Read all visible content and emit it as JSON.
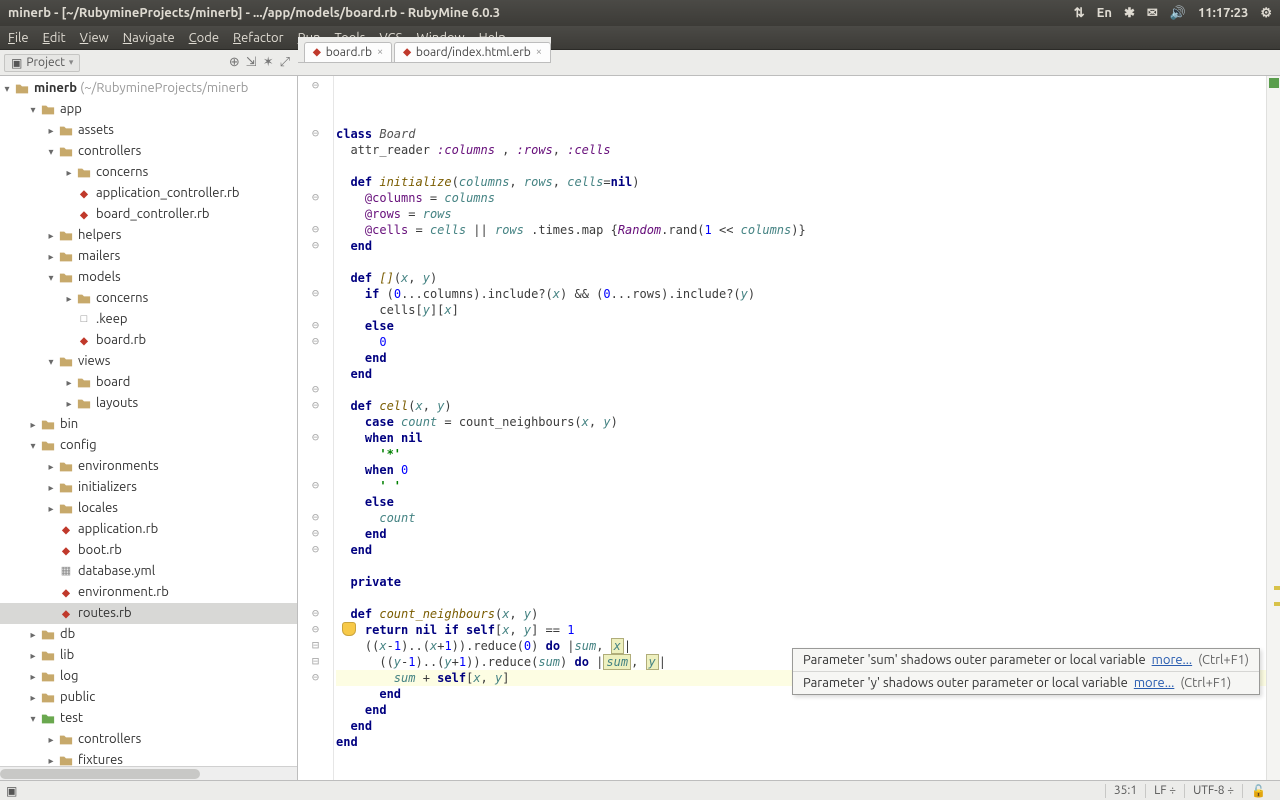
{
  "titlebar": {
    "title": "minerb - [~/RubymineProjects/minerb] - .../app/models/board.rb - RubyMine 6.0.3",
    "tray": {
      "time": "11:17:23",
      "lang": "En"
    }
  },
  "menubar": [
    "File",
    "Edit",
    "View",
    "Navigate",
    "Code",
    "Refactor",
    "Run",
    "Tools",
    "VCS",
    "Window",
    "Help"
  ],
  "toolpanel": {
    "label": "Project"
  },
  "project_tree": {
    "root": {
      "name": "minerb",
      "hint": "(~/RubymineProjects/minerb"
    },
    "nodes": [
      {
        "d": 1,
        "t": "dir",
        "open": true,
        "n": "app"
      },
      {
        "d": 2,
        "t": "dir",
        "open": false,
        "n": "assets"
      },
      {
        "d": 2,
        "t": "dir",
        "open": true,
        "n": "controllers"
      },
      {
        "d": 3,
        "t": "dir",
        "open": false,
        "n": "concerns"
      },
      {
        "d": 3,
        "t": "rb",
        "n": "application_controller.rb"
      },
      {
        "d": 3,
        "t": "rb",
        "n": "board_controller.rb"
      },
      {
        "d": 2,
        "t": "dir",
        "open": false,
        "n": "helpers"
      },
      {
        "d": 2,
        "t": "dir",
        "open": false,
        "n": "mailers"
      },
      {
        "d": 2,
        "t": "dir",
        "open": true,
        "n": "models"
      },
      {
        "d": 3,
        "t": "dir",
        "open": false,
        "n": "concerns"
      },
      {
        "d": 3,
        "t": "file",
        "n": ".keep"
      },
      {
        "d": 3,
        "t": "rb",
        "n": "board.rb"
      },
      {
        "d": 2,
        "t": "dir",
        "open": true,
        "n": "views"
      },
      {
        "d": 3,
        "t": "dir",
        "open": false,
        "n": "board"
      },
      {
        "d": 3,
        "t": "dir",
        "open": false,
        "n": "layouts"
      },
      {
        "d": 1,
        "t": "dir",
        "open": false,
        "n": "bin"
      },
      {
        "d": 1,
        "t": "dir",
        "open": true,
        "n": "config"
      },
      {
        "d": 2,
        "t": "dir",
        "open": false,
        "n": "environments"
      },
      {
        "d": 2,
        "t": "dir",
        "open": false,
        "n": "initializers"
      },
      {
        "d": 2,
        "t": "dir",
        "open": false,
        "n": "locales"
      },
      {
        "d": 2,
        "t": "rb",
        "n": "application.rb"
      },
      {
        "d": 2,
        "t": "rb",
        "n": "boot.rb"
      },
      {
        "d": 2,
        "t": "yml",
        "n": "database.yml"
      },
      {
        "d": 2,
        "t": "rb",
        "n": "environment.rb"
      },
      {
        "d": 2,
        "t": "rb",
        "n": "routes.rb",
        "sel": true
      },
      {
        "d": 1,
        "t": "dir",
        "open": false,
        "n": "db"
      },
      {
        "d": 1,
        "t": "dir",
        "open": false,
        "n": "lib"
      },
      {
        "d": 1,
        "t": "dir",
        "open": false,
        "n": "log"
      },
      {
        "d": 1,
        "t": "dir",
        "open": false,
        "n": "public"
      },
      {
        "d": 1,
        "t": "dir",
        "open": true,
        "test": true,
        "n": "test"
      },
      {
        "d": 2,
        "t": "dir",
        "open": false,
        "n": "controllers"
      },
      {
        "d": 2,
        "t": "dir",
        "open": false,
        "n": "fixtures"
      }
    ]
  },
  "tabs": [
    {
      "label": "board.rb",
      "icon": "rb"
    },
    {
      "label": "board/index.html.erb",
      "icon": "rb"
    }
  ],
  "gutter_folds": [
    1,
    0,
    0,
    1,
    0,
    0,
    0,
    1,
    0,
    1,
    1,
    0,
    0,
    1,
    0,
    1,
    1,
    0,
    0,
    1,
    1,
    0,
    1,
    0,
    0,
    1,
    0,
    1,
    1,
    1,
    0,
    0,
    0,
    1,
    1,
    2,
    2,
    1,
    0,
    1,
    1,
    1,
    1
  ],
  "code_lines": [
    [
      [
        "kw",
        "class "
      ],
      [
        "cls",
        "Board"
      ]
    ],
    [
      [
        "",
        "  attr_reader "
      ],
      [
        "sym",
        ":columns"
      ],
      [
        "",
        ""
      ],
      [
        "",
        " , "
      ],
      [
        "sym",
        ":rows"
      ],
      [
        "",
        ", "
      ],
      [
        "sym",
        ":cells"
      ]
    ],
    [
      [
        "",
        ""
      ]
    ],
    [
      [
        "",
        "  "
      ],
      [
        "kw",
        "def "
      ],
      [
        "fn",
        "initialize"
      ],
      [
        "",
        "("
      ],
      [
        "prm",
        "columns"
      ],
      [
        "",
        ", "
      ],
      [
        "prm",
        "rows"
      ],
      [
        "",
        ", "
      ],
      [
        "prm",
        "cells"
      ],
      [
        "",
        "="
      ],
      [
        "kw",
        "nil"
      ],
      [
        "",
        ")"
      ]
    ],
    [
      [
        "",
        "    "
      ],
      [
        "iv",
        "@columns"
      ],
      [
        "",
        ""
      ],
      [
        "",
        ""
      ],
      [
        "",
        " = "
      ],
      [
        "prm",
        "columns"
      ]
    ],
    [
      [
        "",
        "    "
      ],
      [
        "iv",
        "@rows"
      ],
      [
        "",
        ""
      ],
      [
        "",
        " = "
      ],
      [
        "prm",
        "rows"
      ]
    ],
    [
      [
        "",
        "    "
      ],
      [
        "iv",
        "@cells"
      ],
      [
        "",
        ""
      ],
      [
        "",
        " = "
      ],
      [
        "prm",
        "cells"
      ],
      [
        "",
        ""
      ],
      [
        "",
        " || "
      ],
      [
        "prm",
        "rows"
      ],
      [
        "",
        " .times.map {"
      ],
      [
        "cnst",
        "Random"
      ],
      [
        "",
        ".rand("
      ],
      [
        "num",
        "1"
      ],
      [
        "",
        ""
      ],
      [
        "",
        " << "
      ],
      [
        "prm",
        "columns"
      ],
      [
        "",
        ")}"
      ]
    ],
    [
      [
        "",
        "  "
      ],
      [
        "kw",
        "end"
      ]
    ],
    [
      [
        "",
        ""
      ]
    ],
    [
      [
        "",
        "  "
      ],
      [
        "kw",
        "def "
      ],
      [
        "fn",
        "[]"
      ],
      [
        "",
        "("
      ],
      [
        "prm",
        "x"
      ],
      [
        "",
        ", "
      ],
      [
        "prm",
        "y"
      ],
      [
        "",
        ")"
      ]
    ],
    [
      [
        "",
        "    "
      ],
      [
        "kw",
        "if "
      ],
      [
        "",
        "("
      ],
      [
        "num",
        "0"
      ],
      [
        "",
        "...columns).include?("
      ],
      [
        "prm",
        "x"
      ],
      [
        "",
        ") && ("
      ],
      [
        "num",
        "0"
      ],
      [
        "",
        "...rows).include?("
      ],
      [
        "prm",
        "y"
      ],
      [
        "",
        ")"
      ]
    ],
    [
      [
        "",
        "      cells["
      ],
      [
        "prm",
        "y"
      ],
      [
        "",
        "]["
      ],
      [
        "prm",
        "x"
      ],
      [
        "",
        "]"
      ]
    ],
    [
      [
        "",
        "    "
      ],
      [
        "kw",
        "else"
      ]
    ],
    [
      [
        "",
        "      "
      ],
      [
        "num",
        "0"
      ]
    ],
    [
      [
        "",
        "    "
      ],
      [
        "kw",
        "end"
      ]
    ],
    [
      [
        "",
        "  "
      ],
      [
        "kw",
        "end"
      ]
    ],
    [
      [
        "",
        ""
      ]
    ],
    [
      [
        "",
        "  "
      ],
      [
        "kw",
        "def "
      ],
      [
        "fn",
        "cell"
      ],
      [
        "",
        "("
      ],
      [
        "prm",
        "x"
      ],
      [
        "",
        ", "
      ],
      [
        "prm",
        "y"
      ],
      [
        "",
        ")"
      ]
    ],
    [
      [
        "",
        "    "
      ],
      [
        "kw",
        "case "
      ],
      [
        "prm",
        "count"
      ],
      [
        "",
        ""
      ],
      [
        "",
        " = count_neighbours("
      ],
      [
        "prm",
        "x"
      ],
      [
        "",
        ", "
      ],
      [
        "prm",
        "y"
      ],
      [
        "",
        ")"
      ]
    ],
    [
      [
        "",
        "    "
      ],
      [
        "kw",
        "when "
      ],
      [
        "kw",
        "nil"
      ]
    ],
    [
      [
        "",
        "      "
      ],
      [
        "str",
        "'*'"
      ]
    ],
    [
      [
        "",
        "    "
      ],
      [
        "kw",
        "when "
      ],
      [
        "num",
        "0"
      ]
    ],
    [
      [
        "",
        "      "
      ],
      [
        "str",
        "' '"
      ]
    ],
    [
      [
        "",
        "    "
      ],
      [
        "kw",
        "else"
      ]
    ],
    [
      [
        "",
        "      "
      ],
      [
        "prm",
        "count"
      ]
    ],
    [
      [
        "",
        "    "
      ],
      [
        "kw",
        "end"
      ]
    ],
    [
      [
        "",
        "  "
      ],
      [
        "kw",
        "end"
      ]
    ],
    [
      [
        "",
        ""
      ]
    ],
    [
      [
        "",
        "  "
      ],
      [
        "kw",
        "private"
      ]
    ],
    [
      [
        "",
        ""
      ]
    ],
    [
      [
        "",
        "  "
      ],
      [
        "kw",
        "def "
      ],
      [
        "fn",
        "count_neighbours"
      ],
      [
        "",
        "("
      ],
      [
        "prm",
        "x"
      ],
      [
        "",
        ", "
      ],
      [
        "prm",
        "y"
      ],
      [
        "",
        ")"
      ]
    ],
    [
      [
        "",
        "    "
      ],
      [
        "kw",
        "return nil if self"
      ],
      [
        "",
        "["
      ],
      [
        "prm",
        "x"
      ],
      [
        "",
        ", "
      ],
      [
        "prm",
        "y"
      ],
      [
        "",
        "] == "
      ],
      [
        "num",
        "1"
      ]
    ],
    [
      [
        "",
        "    (("
      ],
      [
        "prm",
        "x"
      ],
      [
        "",
        "-"
      ],
      [
        "num",
        "1"
      ],
      [
        "",
        ")..("
      ],
      [
        "prm",
        "x"
      ],
      [
        "",
        "+"
      ],
      [
        "num",
        "1"
      ],
      [
        "",
        ")).reduce("
      ],
      [
        "num",
        "0"
      ],
      [
        "",
        ") "
      ],
      [
        "kw",
        "do"
      ],
      [
        "",
        ""
      ],
      [
        "",
        " |"
      ],
      [
        "prm",
        "sum"
      ],
      [
        "",
        ", "
      ],
      [
        "warn",
        "x"
      ],
      [
        "",
        "|"
      ]
    ],
    [
      [
        "",
        "      (("
      ],
      [
        "prm",
        "y"
      ],
      [
        "",
        "-"
      ],
      [
        "num",
        "1"
      ],
      [
        "",
        ")..("
      ],
      [
        "prm",
        "y"
      ],
      [
        "",
        "+"
      ],
      [
        "num",
        "1"
      ],
      [
        "",
        ")).reduce("
      ],
      [
        "prm",
        "sum"
      ],
      [
        "",
        ") "
      ],
      [
        "kw",
        "do"
      ],
      [
        "",
        ""
      ],
      [
        "",
        " |"
      ],
      [
        "warn",
        "sum"
      ],
      [
        "",
        ", "
      ],
      [
        "warn",
        "y"
      ],
      [
        "",
        "|"
      ]
    ],
    [
      [
        "",
        "        "
      ],
      [
        "prm",
        "sum"
      ],
      [
        "",
        ""
      ],
      [
        "",
        " + "
      ],
      [
        "kw",
        "self"
      ],
      [
        "",
        "["
      ],
      [
        "prm",
        "x"
      ],
      [
        "",
        ", "
      ],
      [
        "prm",
        "y"
      ],
      [
        "",
        "]"
      ]
    ],
    [
      [
        "",
        "      "
      ],
      [
        "kw",
        "end"
      ]
    ],
    [
      [
        "",
        "    "
      ],
      [
        "kw",
        "end"
      ]
    ],
    [
      [
        "",
        "  "
      ],
      [
        "kw",
        "end"
      ]
    ],
    [
      [
        "kw",
        "end"
      ]
    ]
  ],
  "highlight_line_index": 34,
  "tooltip": {
    "rows": [
      {
        "msg": "Parameter 'sum' shadows outer parameter or local variable",
        "link": "more...",
        "sc": "(Ctrl+F1)"
      },
      {
        "msg": "Parameter 'y' shadows outer parameter or local variable",
        "link": "more...",
        "sc": "(Ctrl+F1)"
      }
    ]
  },
  "statusbar": {
    "pos": "35:1",
    "le": "LF",
    "enc": "UTF-8"
  }
}
